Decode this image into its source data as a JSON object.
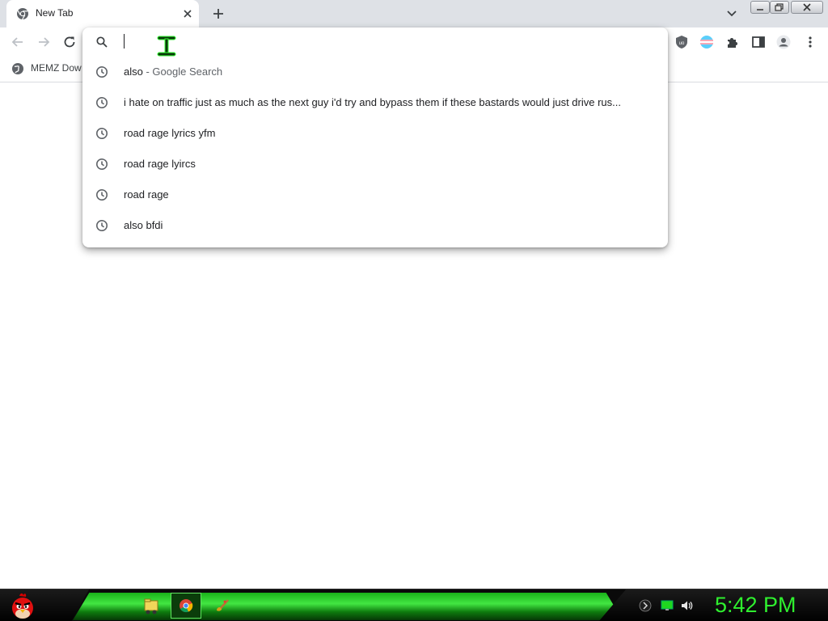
{
  "tab": {
    "title": "New Tab"
  },
  "omnibox": {
    "input_value": "",
    "suggestions": [
      {
        "text": "also",
        "suffix": " - Google Search",
        "icon": "search-icon"
      },
      {
        "text": "i hate on traffic just as much as the next guy i'd try and bypass them if these bastards would just drive rus...",
        "suffix": "",
        "icon": "history-icon"
      },
      {
        "text": "road rage lyrics yfm",
        "suffix": "",
        "icon": "history-icon"
      },
      {
        "text": "road rage lyircs",
        "suffix": "",
        "icon": "history-icon"
      },
      {
        "text": "road rage",
        "suffix": "",
        "icon": "history-icon"
      },
      {
        "text": "also bfdi",
        "suffix": "",
        "icon": "history-icon"
      }
    ]
  },
  "bookmarks": [
    {
      "label": "MEMZ Dow",
      "icon": "globe-icon"
    }
  ],
  "toolbar_icons": [
    "back-arrow-icon",
    "forward-arrow-icon",
    "reload-icon",
    "ublock-icon",
    "flag-extension-icon",
    "puzzle-icon",
    "side-panel-icon",
    "profile-icon",
    "more-icon"
  ],
  "taskbar": {
    "clock": "5:42 PM",
    "items": [
      "file-manager-icon",
      "chrome-icon",
      "paint-icon"
    ],
    "tray": [
      "ghost-icon",
      "network-icon",
      "volume-icon"
    ]
  },
  "colors": {
    "accent_green": "#2ff02f",
    "tab_strip": "#dee1e6",
    "text": "#202124",
    "muted_text": "#5f6368"
  }
}
